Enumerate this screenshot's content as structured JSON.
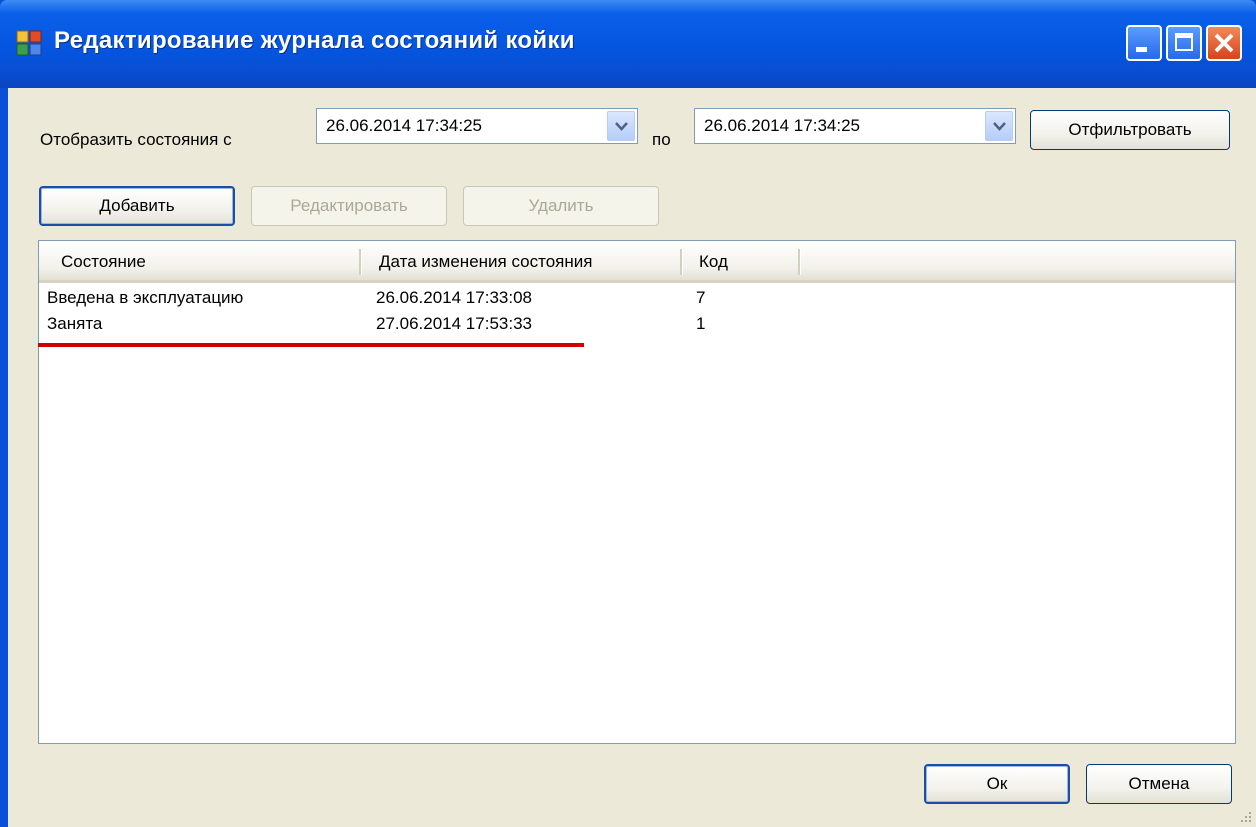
{
  "window": {
    "title": "Редактирование журнала состояний койки",
    "app_icon": "window-app-icon",
    "controls": [
      "minimize-icon",
      "maximize-icon",
      "close-icon"
    ]
  },
  "filter": {
    "label_from": "Отобразить состояния с",
    "date_from": "26.06.2014 17:34:25",
    "label_to": "по",
    "date_to": "26.06.2014 17:34:25",
    "filter_button": "Отфильтровать"
  },
  "toolbar": {
    "add_label": "Добавить",
    "edit_label": "Редактировать",
    "delete_label": "Удалить"
  },
  "table": {
    "columns": [
      "Состояние",
      "Дата изменения состояния",
      "Код"
    ],
    "rows": [
      {
        "state": "Введена в эксплуатацию",
        "date": "26.06.2014 17:33:08",
        "code": "7"
      },
      {
        "state": "Занята",
        "date": "27.06.2014 17:53:33",
        "code": "1"
      }
    ]
  },
  "footer": {
    "ok_label": "Ок",
    "cancel_label": "Отмена"
  },
  "colors": {
    "titlebar": "#0456e0",
    "dialog_bg": "#ece9d8",
    "annotation_underline": "#d00000"
  }
}
